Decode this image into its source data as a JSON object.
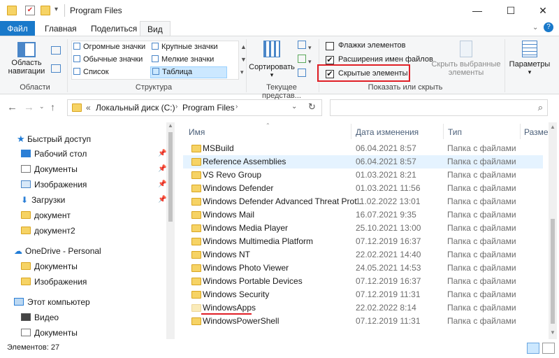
{
  "window": {
    "title": "Program Files",
    "minimize": "—",
    "maximize": "☐",
    "close": "✕"
  },
  "tabs": [
    {
      "label": "Файл"
    },
    {
      "label": "Главная"
    },
    {
      "label": "Поделиться"
    },
    {
      "label": "Вид"
    }
  ],
  "ribbon": {
    "nav_pane_label_line1": "Область",
    "nav_pane_label_line2": "навигации",
    "areas_group": "Области",
    "layout": {
      "items": [
        "Огромные значки",
        "Крупные значки",
        "Обычные значки",
        "Мелкие значки",
        "Список",
        "Таблица"
      ],
      "group": "Структура"
    },
    "sort_label": "Сортировать",
    "current_view_group": "Текущее представ...",
    "show_hide": {
      "item_checkboxes": "Флажки элементов",
      "file_extensions": "Расширения имен файлов",
      "hidden_items": "Скрытые элементы",
      "item_checkboxes_checked": false,
      "file_extensions_checked": true,
      "hidden_items_checked": true,
      "hide_selected_line1": "Скрыть выбранные",
      "hide_selected_line2": "элементы",
      "group": "Показать или скрыть"
    },
    "options_label": "Параметры",
    "highlight_color": "#e01f26"
  },
  "address": {
    "breadcrumb_prefix": "«",
    "segments": [
      "Локальный диск (C:)",
      "Program Files"
    ]
  },
  "nav": {
    "items": [
      {
        "label": "Быстрый доступ",
        "icon": "star-icon"
      },
      {
        "label": "Рабочий стол",
        "icon": "desktop-icon"
      },
      {
        "label": "Документы",
        "icon": "documents-icon"
      },
      {
        "label": "Изображения",
        "icon": "pictures-icon"
      },
      {
        "label": "Загрузки",
        "icon": "download-icon"
      },
      {
        "label": "документ",
        "icon": "folder-icon"
      },
      {
        "label": "документ2",
        "icon": "folder-icon"
      },
      {
        "label": "OneDrive - Personal",
        "icon": "cloud-icon"
      },
      {
        "label": "Документы",
        "icon": "folder-icon"
      },
      {
        "label": "Изображения",
        "icon": "folder-icon"
      },
      {
        "label": "Этот компьютер",
        "icon": "computer-icon"
      },
      {
        "label": "Видео",
        "icon": "video-icon"
      },
      {
        "label": "Документы",
        "icon": "documents-icon"
      }
    ]
  },
  "files": {
    "columns": [
      "Имя",
      "Дата изменения",
      "Тип",
      "Разме"
    ],
    "rows": [
      {
        "name": "MSBuild",
        "date": "06.04.2021 8:57",
        "type": "Папка с файлами"
      },
      {
        "name": "Reference Assemblies",
        "date": "06.04.2021 8:57",
        "type": "Папка с файлами"
      },
      {
        "name": "VS Revo Group",
        "date": "01.03.2021 8:21",
        "type": "Папка с файлами"
      },
      {
        "name": "Windows Defender",
        "date": "01.03.2021 11:56",
        "type": "Папка с файлами"
      },
      {
        "name": "Windows Defender Advanced Threat Prot...",
        "date": "11.02.2022 13:01",
        "type": "Папка с файлами"
      },
      {
        "name": "Windows Mail",
        "date": "16.07.2021 9:35",
        "type": "Папка с файлами"
      },
      {
        "name": "Windows Media Player",
        "date": "25.10.2021 13:00",
        "type": "Папка с файлами"
      },
      {
        "name": "Windows Multimedia Platform",
        "date": "07.12.2019 16:37",
        "type": "Папка с файлами"
      },
      {
        "name": "Windows NT",
        "date": "22.02.2021 14:40",
        "type": "Папка с файлами"
      },
      {
        "name": "Windows Photo Viewer",
        "date": "24.05.2021 14:53",
        "type": "Папка с файлами"
      },
      {
        "name": "Windows Portable Devices",
        "date": "07.12.2019 16:37",
        "type": "Папка с файлами"
      },
      {
        "name": "Windows Security",
        "date": "07.12.2019 11:31",
        "type": "Папка с файлами"
      },
      {
        "name": "WindowsApps",
        "date": "22.02.2022 8:14",
        "type": "Папка с файлами"
      },
      {
        "name": "WindowsPowerShell",
        "date": "07.12.2019 11:31",
        "type": "Папка с файлами"
      }
    ],
    "selected_row": 1,
    "hidden_row": 12
  },
  "status": {
    "count": "Элементов: 27"
  }
}
